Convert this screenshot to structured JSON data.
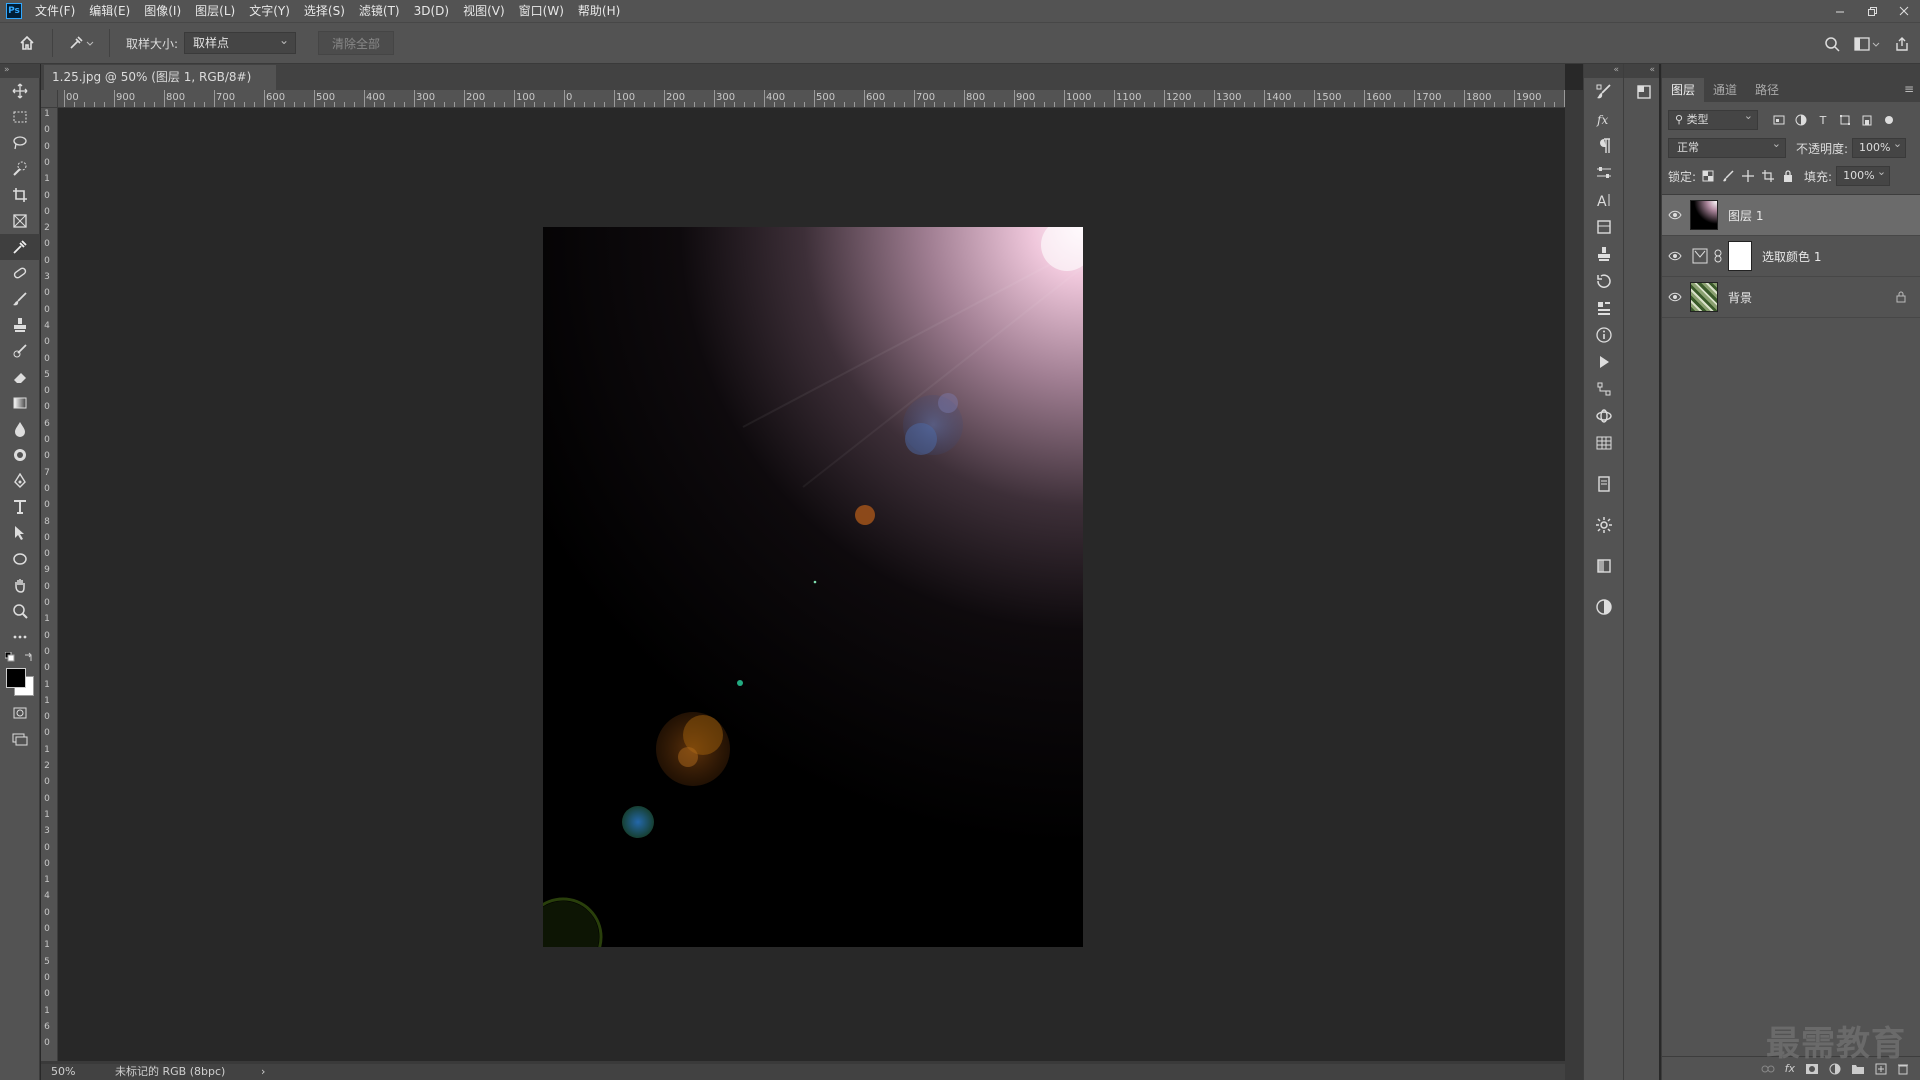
{
  "app": {
    "logo": "Ps",
    "menu": [
      "文件(F)",
      "编辑(E)",
      "图像(I)",
      "图层(L)",
      "文字(Y)",
      "选择(S)",
      "滤镜(T)",
      "3D(D)",
      "视图(V)",
      "窗口(W)",
      "帮助(H)"
    ],
    "window_controls": [
      "minimize-icon",
      "restore-icon",
      "close-icon"
    ]
  },
  "options": {
    "sample_size_label": "取样大小:",
    "sample_size_value": "取样点",
    "clear_all_label": "清除全部"
  },
  "document": {
    "tab_title": "1.25.jpg @ 50% (图层 1, RGB/8#) *",
    "zoom": "50%",
    "color_info": "未标记的 RGB (8bpc)"
  },
  "ruler": {
    "h_labels": [
      "00",
      "900",
      "800",
      "700",
      "600",
      "500",
      "400",
      "300",
      "200",
      "100",
      "0",
      "100",
      "200",
      "300",
      "400",
      "500",
      "600",
      "700",
      "800",
      "900",
      "1000",
      "1100",
      "1200",
      "1300",
      "1400",
      "1500",
      "1600",
      "1700",
      "1800",
      "1900",
      "200"
    ],
    "v_labels": [
      "1",
      "0",
      "0",
      "0",
      "1",
      "0",
      "0",
      "2",
      "0",
      "0",
      "3",
      "0",
      "0",
      "4",
      "0",
      "0",
      "5",
      "0",
      "0",
      "6",
      "0",
      "0",
      "7",
      "0",
      "0",
      "8",
      "0",
      "0",
      "9",
      "0",
      "0",
      "1",
      "0",
      "0",
      "0",
      "1",
      "1",
      "0",
      "0",
      "1",
      "2",
      "0",
      "0",
      "1",
      "3",
      "0",
      "0",
      "1",
      "4",
      "0",
      "0",
      "1",
      "5",
      "0",
      "0",
      "1",
      "6",
      "0"
    ]
  },
  "layers_panel": {
    "tabs": [
      "图层",
      "通道",
      "路径"
    ],
    "filter_label": "类型",
    "blend_mode": "正常",
    "opacity_label": "不透明度:",
    "opacity_value": "100%",
    "lock_label": "锁定:",
    "fill_label": "填充:",
    "fill_value": "100%",
    "layers": [
      {
        "name": "图层 1",
        "selected": true
      },
      {
        "name": "选取颜色 1",
        "selected": false
      },
      {
        "name": "背景",
        "selected": false,
        "locked": true
      }
    ]
  },
  "watermark": "最需教育",
  "colors": {
    "panel": "#535353",
    "canvas_bg": "#282828",
    "selected_layer": "#6b6b6b"
  }
}
